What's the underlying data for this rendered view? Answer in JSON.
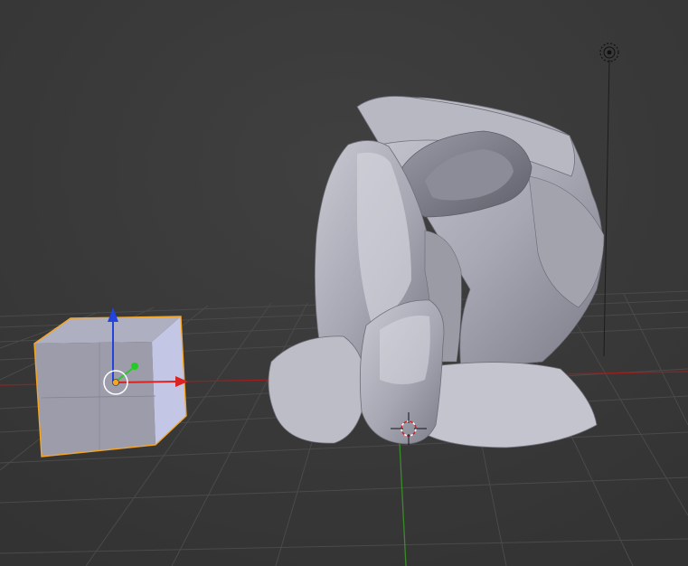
{
  "app": "Blender",
  "view": {
    "type": "3d-viewport",
    "perspective": "user-perspective",
    "background_color": "#393939",
    "grid_visible": true
  },
  "objects": [
    {
      "name": "cube",
      "selected": true,
      "outline_color": "#f5a623"
    },
    {
      "name": "sculpted-mesh",
      "selected": false
    }
  ],
  "overlays": {
    "x_axis_color": "#9a1f1f",
    "y_axis_color": "#3a8a2a",
    "gizmo_x_color": "#dd2222",
    "gizmo_y_color": "#22cc22",
    "gizmo_z_color": "#2244dd",
    "cursor": "3d-cursor",
    "light": "lamp-object"
  },
  "icons": [
    "3d-cursor-icon",
    "lamp-icon",
    "object-origin-icon",
    "transform-gizmo-icon"
  ]
}
